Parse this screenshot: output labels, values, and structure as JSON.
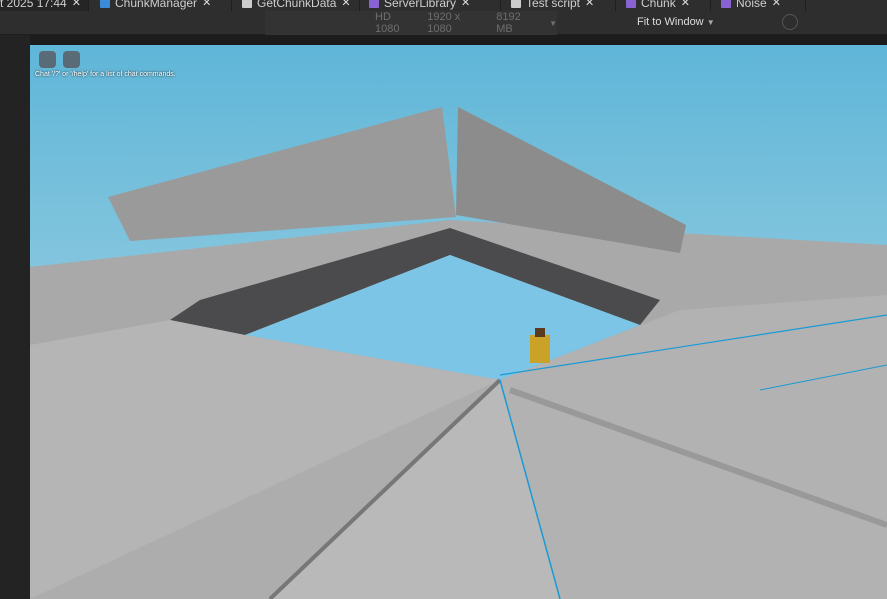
{
  "tabs": [
    {
      "label": "t 2025 17:44",
      "active": true,
      "icon": "none"
    },
    {
      "label": "ChunkManager",
      "icon": "module-script-icon",
      "color": "#3a8bd8"
    },
    {
      "label": "GetChunkData",
      "icon": "script-icon",
      "color": "#cccccc"
    },
    {
      "label": "ServerLibrary",
      "icon": "module-script-icon",
      "color": "#8a63d2"
    },
    {
      "label": "Test script",
      "icon": "script-icon",
      "color": "#cccccc"
    },
    {
      "label": "Chunk",
      "icon": "module-script-icon",
      "color": "#8a63d2"
    },
    {
      "label": "Noise",
      "icon": "module-script-icon",
      "color": "#8a63d2"
    }
  ],
  "toolbar": {
    "device": "HD 1080",
    "resolution": "1920 x 1080",
    "memory": "8192 MB",
    "fit": "Fit to Window"
  },
  "viewport": {
    "chat_hint": "Chat '/?' or '/help' for a list of chat commands."
  }
}
